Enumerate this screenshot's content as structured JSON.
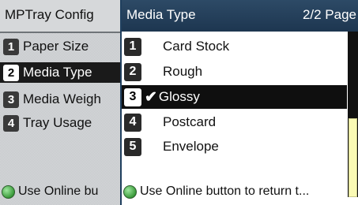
{
  "left_panel": {
    "title": "MPTray Config",
    "items": [
      {
        "num": "1",
        "label": "Paper Size"
      },
      {
        "num": "2",
        "label": "Media Type"
      },
      {
        "num": "3",
        "label": "Media Weigh"
      },
      {
        "num": "4",
        "label": "Tray Usage"
      }
    ],
    "selected_index": 1,
    "footer": "Use Online bu"
  },
  "right_panel": {
    "title": "Media Type",
    "page": "2/2 Page",
    "items": [
      {
        "num": "1",
        "label": "Card Stock"
      },
      {
        "num": "2",
        "label": "Rough"
      },
      {
        "num": "3",
        "label": "Glossy",
        "checked": true
      },
      {
        "num": "4",
        "label": "Postcard"
      },
      {
        "num": "5",
        "label": "Envelope"
      }
    ],
    "selected_index": 2,
    "check_icon": "checkmark-icon",
    "footer": "Use Online button to return t..."
  },
  "colors": {
    "header_bg": "#1f3f5e",
    "selected_bg": "#0f0f0f",
    "scroll_thumb": "#fafab4",
    "online_led": "#3a9a3a"
  }
}
